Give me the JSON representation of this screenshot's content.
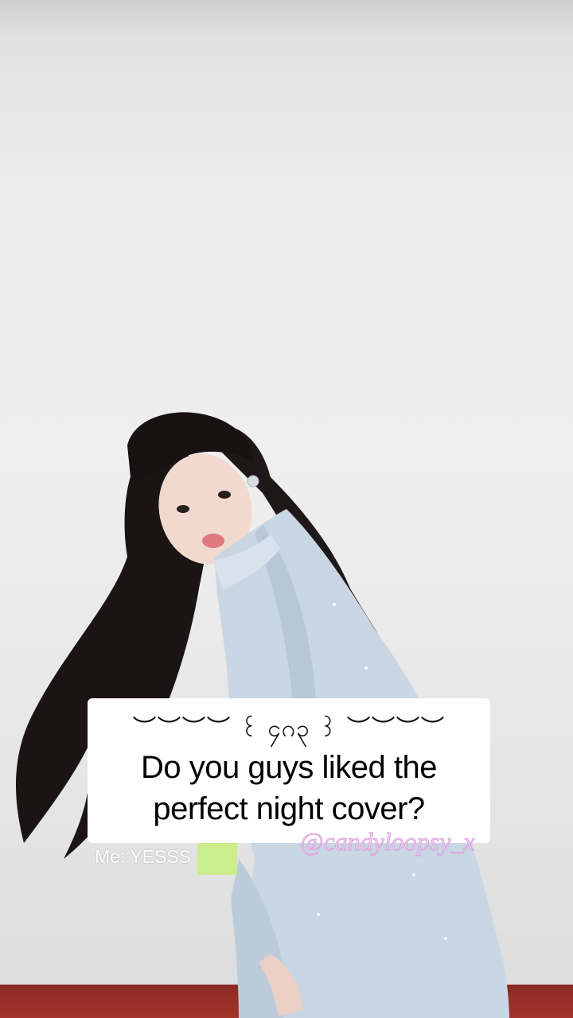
{
  "caption": {
    "decoration": "︶︶︶︶ ꒰ ၄ဂ၃ ꒱ ︶︶︶︶",
    "line1": "Do you guys liked the",
    "line2": "perfect night cover?"
  },
  "overlay": {
    "reply": "Me: YESSS",
    "watermark": "@candyloopsy_x"
  },
  "colors": {
    "wall": "#ececed",
    "outfit": "#c9d6e3",
    "hair": "#1a1414",
    "floor": "#a3332b",
    "watermark": "#f0c8ee"
  }
}
